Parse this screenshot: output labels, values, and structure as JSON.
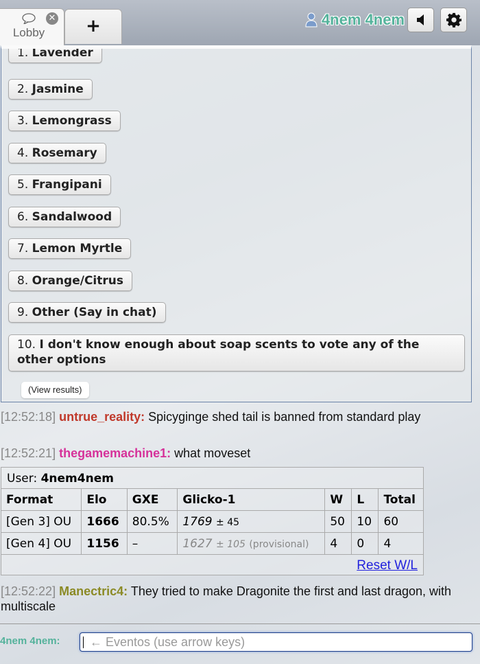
{
  "header": {
    "tabs": [
      {
        "label": "Lobby",
        "icon": "speech-bubble-icon",
        "closable": true
      },
      {
        "label": "+",
        "icon": "plus-icon"
      }
    ],
    "username": "4nem 4nem",
    "buttons": [
      {
        "name": "sound",
        "icon": "speaker-icon"
      },
      {
        "name": "settings",
        "icon": "gear-icon"
      }
    ]
  },
  "poll": {
    "options": [
      {
        "num": "1.",
        "label": "Lavender"
      },
      {
        "num": "2.",
        "label": "Jasmine"
      },
      {
        "num": "3.",
        "label": "Lemongrass"
      },
      {
        "num": "4.",
        "label": "Rosemary"
      },
      {
        "num": "5.",
        "label": "Frangipani"
      },
      {
        "num": "6.",
        "label": "Sandalwood"
      },
      {
        "num": "7.",
        "label": "Lemon Myrtle"
      },
      {
        "num": "8.",
        "label": "Orange/Citrus"
      },
      {
        "num": "9.",
        "label": "Other (Say in chat)"
      },
      {
        "num": "10.",
        "label": "I don't know enough about soap scents to vote any of the other options"
      }
    ],
    "view_results_label": "(View results)"
  },
  "chat": {
    "messages": [
      {
        "time": "[12:52:18]",
        "user": "untrue_reality:",
        "color": "#c0392b",
        "text": "Spicyginge shed tail is banned from standard play"
      },
      {
        "time": "[12:52:21]",
        "user": "thegamemachine1:",
        "color": "#d6329a",
        "text": "what moveset"
      },
      {
        "time": "[12:52:22]",
        "user": "Manectric4:",
        "color": "#8b8a25",
        "text": "They tried to make Dragonite the first and last dragon, with multiscale"
      }
    ],
    "ranking": {
      "user_label": "User:",
      "user": "4nem4nem",
      "headers": [
        "Format",
        "Elo",
        "GXE",
        "Glicko-1",
        "W",
        "L",
        "Total"
      ],
      "rows": [
        {
          "format": "[Gen 3] OU",
          "elo": "1666",
          "gxe": "80.5%",
          "glicko": "1769",
          "deviation": "± 45",
          "provisional": "",
          "w": "50",
          "l": "10",
          "total": "60"
        },
        {
          "format": "[Gen 4] OU",
          "elo": "1156",
          "gxe": "–",
          "glicko": "1627",
          "deviation": "± 105",
          "provisional": "(provisional)",
          "w": "4",
          "l": "0",
          "total": "4"
        }
      ],
      "reset_label": "Reset W/L"
    }
  },
  "input": {
    "prompt": "4nem 4nem:",
    "placeholder": "← Eventos (use arrow keys)"
  }
}
